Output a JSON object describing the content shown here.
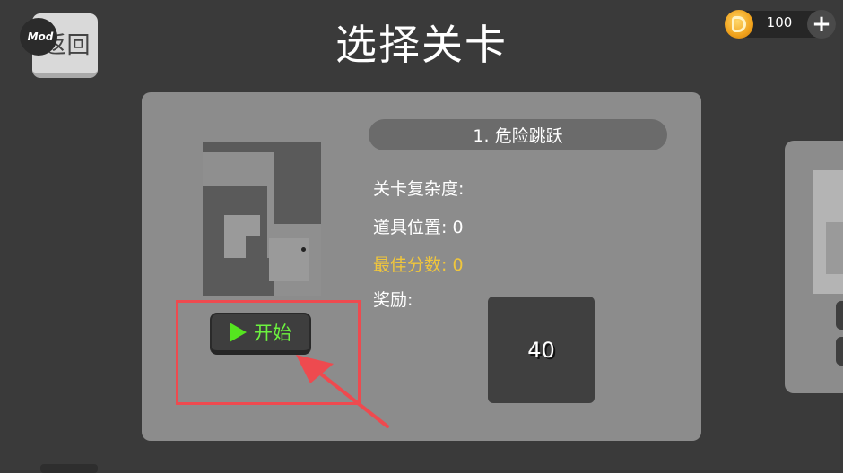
{
  "header": {
    "title": "选择关卡",
    "back_label": "返回",
    "mod_badge": "Mod",
    "coins": "100",
    "add_label": "+"
  },
  "level": {
    "name": "1. 危险跳跃",
    "complexity_label": "关卡复杂度:",
    "item_position_label": "道具位置: 0",
    "best_score_label": "最佳分数: 0",
    "reward_label": "奖励:",
    "reward_value": "40",
    "start_label": "开始"
  },
  "colors": {
    "background": "#3a3a3a",
    "card": "#8c8c8c",
    "best_score": "#f0c63c",
    "start_text": "#6cf23f",
    "highlight": "#ee4a4f",
    "coin": "#f0a21c"
  }
}
